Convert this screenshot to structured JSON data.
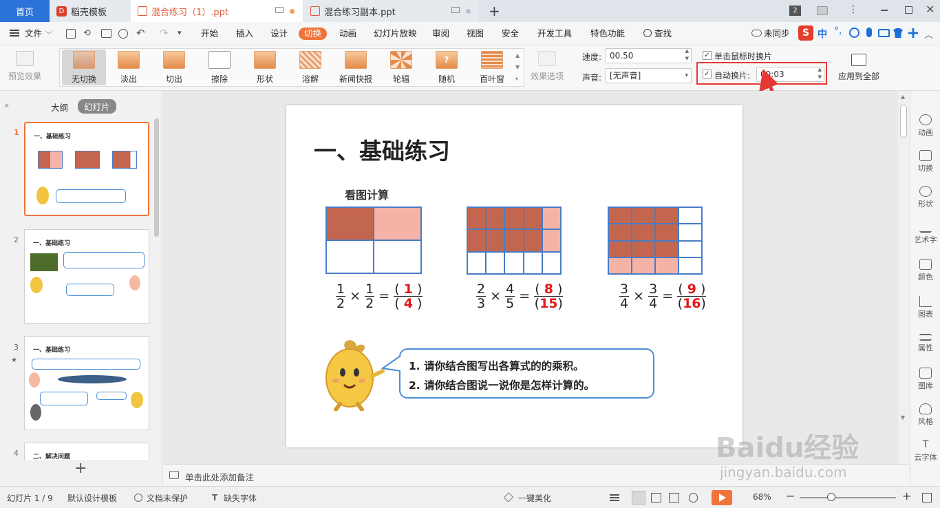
{
  "tabs": {
    "home": "首页",
    "template": "稻壳模板",
    "doc1": "混合练习（1）.ppt",
    "doc2": "混合练习副本.ppt",
    "plus": "+",
    "badge": "2"
  },
  "menu": {
    "file": "文件",
    "items": [
      "开始",
      "插入",
      "设计",
      "切换",
      "动画",
      "幻灯片放映",
      "审阅",
      "视图",
      "安全",
      "开发工具",
      "特色功能"
    ],
    "active": "切换",
    "search": "查找",
    "sync": "未同步",
    "ime": "中"
  },
  "ribbon": {
    "preview": "预览效果",
    "effects": [
      "无切换",
      "淡出",
      "切出",
      "擦除",
      "形状",
      "溶解",
      "新闻快报",
      "轮辐",
      "随机",
      "百叶窗"
    ],
    "effect_options": "效果选项",
    "speed_label": "速度:",
    "speed_value": "00.50",
    "sound_label": "声音:",
    "sound_value": "[无声音]",
    "click_label": "单击鼠标时换片",
    "auto_label": "自动换片:",
    "auto_value": "00:03",
    "apply_all": "应用到全部"
  },
  "left_panel": {
    "tab_outline": "大纲",
    "tab_slides": "幻灯片",
    "add": "+",
    "thumbs": [
      {
        "num": "1",
        "title": "一、基础练习"
      },
      {
        "num": "2",
        "title": "一、基础练习"
      },
      {
        "num": "3",
        "title": "一、基础练习"
      },
      {
        "num": "4",
        "title": "二、解决问题"
      }
    ]
  },
  "slide": {
    "title": "一、基础练习",
    "subtitle": "看图计算",
    "eq1": {
      "a": "1",
      "b": "2",
      "c": "1",
      "d": "2",
      "r1": "1",
      "r2": "4"
    },
    "eq2": {
      "a": "2",
      "b": "3",
      "c": "4",
      "d": "5",
      "r1": "8",
      "r2": "15"
    },
    "eq3": {
      "a": "3",
      "b": "4",
      "c": "3",
      "d": "4",
      "r1": "9",
      "r2": "16"
    },
    "ops": {
      "times": "×",
      "eq": "=",
      "lp": "(",
      "rp": ")"
    },
    "bubble_line1": "1. 请你结合图写出各算式的的乘积。",
    "bubble_line2": "2. 请你结合图说一说你是怎样计算的。"
  },
  "notes": "单击此处添加备注",
  "right_panel": [
    "动画",
    "切换",
    "形状",
    "艺术字",
    "颜色",
    "图表",
    "属性",
    "图库",
    "风格",
    "云字体"
  ],
  "status": {
    "slide": "幻灯片 1 / 9",
    "design": "默认设计模板",
    "protect": "文档未保护",
    "font": "缺失字体",
    "beautify": "一键美化",
    "zoom": "68%",
    "minus": "−",
    "plus": "+"
  },
  "watermark": {
    "brand": "Baidu经验",
    "url": "jingyan.baidu.com"
  },
  "colors": {
    "accent": "#f0743a",
    "home_tab": "#2b73d8",
    "highlight_box": "#e53935",
    "dark_cell": "#c26650",
    "light_cell": "#f5b3a7"
  }
}
